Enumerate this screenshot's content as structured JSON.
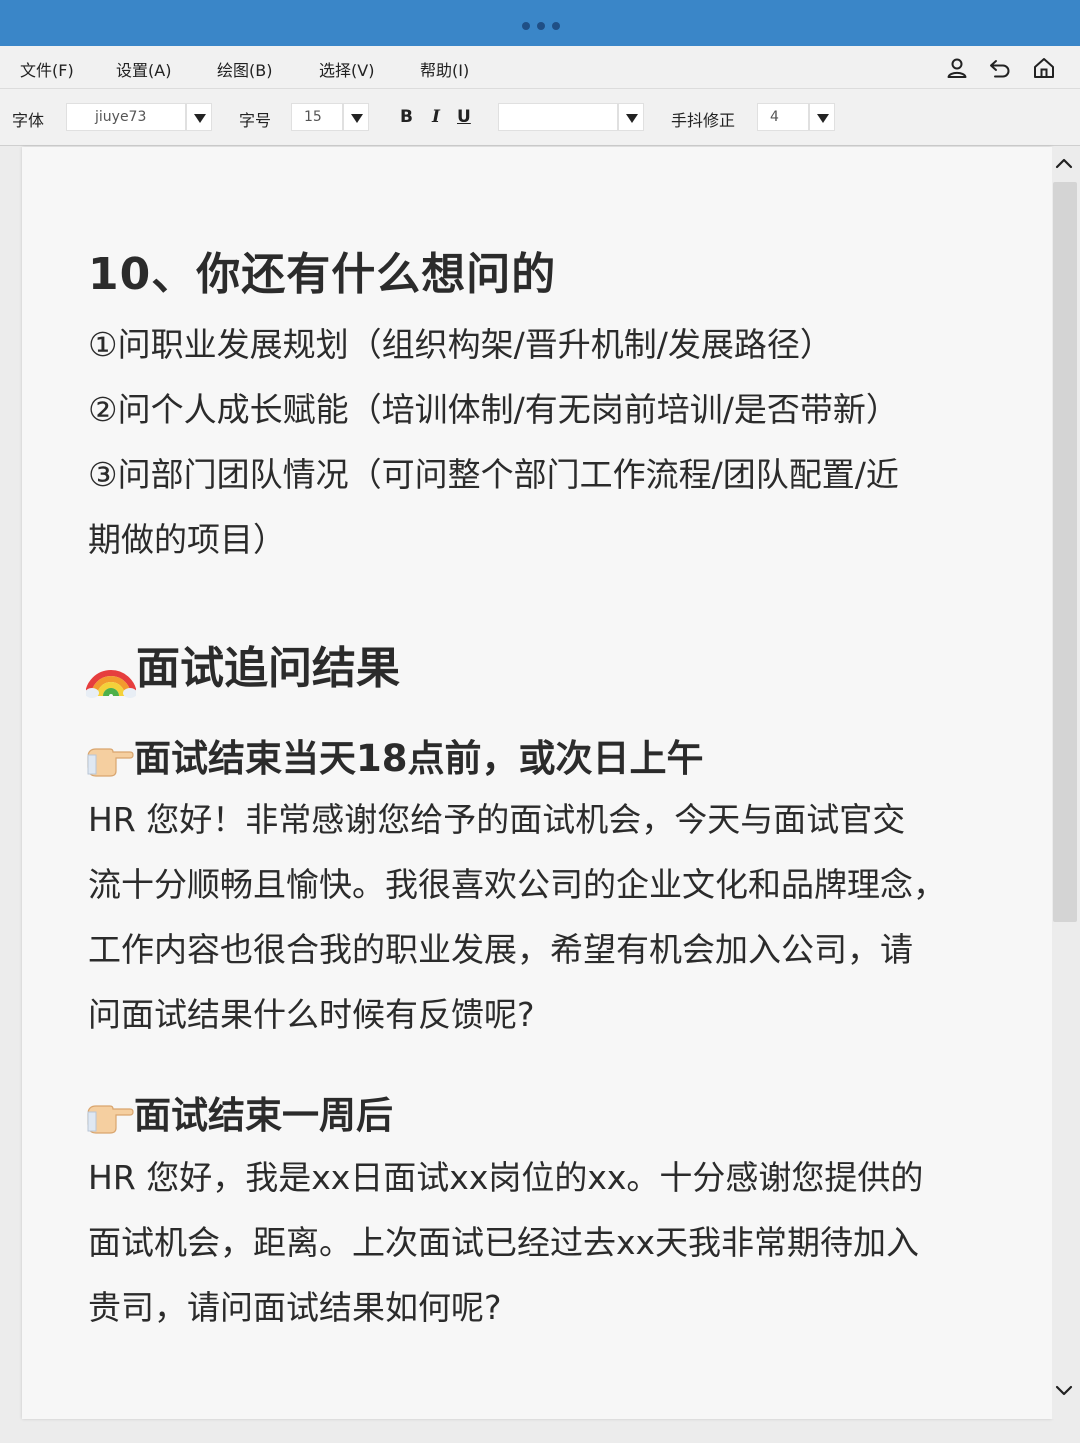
{
  "menu": {
    "items": [
      "文件(F)",
      "设置(A)",
      "绘图(B)",
      "选择(V)",
      "帮助(I)"
    ]
  },
  "toolbar": {
    "font_label": "字体",
    "font_value": "jiuye73",
    "size_label": "字号",
    "size_value": "15",
    "bold": "B",
    "italic": "I",
    "underline": "U",
    "color_value": "",
    "jitter_label": "手抖修正",
    "jitter_value": "4"
  },
  "icons": {
    "user": "user-icon",
    "undo": "undo-icon",
    "home": "home-icon",
    "rainbow": "rainbow-icon",
    "pointing": "pointing-hand-icon"
  },
  "document": {
    "heading": "10、你还有什么想问的",
    "list": [
      "①问职业发展规划（组织构架/晋升机制/发展路径）",
      "②问个人成长赋能（培训体制/有无岗前培训/是否带新）",
      "③问部门团队情况（可问整个部门工作流程/团队配置/近",
      "期做的项目）"
    ],
    "section_title": "面试追问结果",
    "sub1_title": "面试结束当天18点前，或次日上午",
    "sub1_lines": [
      "HR 您好！非常感谢您给予的面试机会，今天与面试官交",
      "流十分顺畅且愉快。我很喜欢公司的企业文化和品牌理念，",
      "工作内容也很合我的职业发展，希望有机会加入公司，请",
      "问面试结果什么时候有反馈呢?"
    ],
    "sub2_title": "面试结束一周后",
    "sub2_lines": [
      "HR 您好，我是xx日面试xx岗位的xx。十分感谢您提供的",
      "面试机会，距离。上次面试已经过去xx天我非常期待加入",
      "贵司，请问面试结果如何呢?"
    ]
  },
  "colors": {
    "titlebar": "#3a86c8",
    "text": "#2b2b2b",
    "page": "#f7f7f7"
  }
}
